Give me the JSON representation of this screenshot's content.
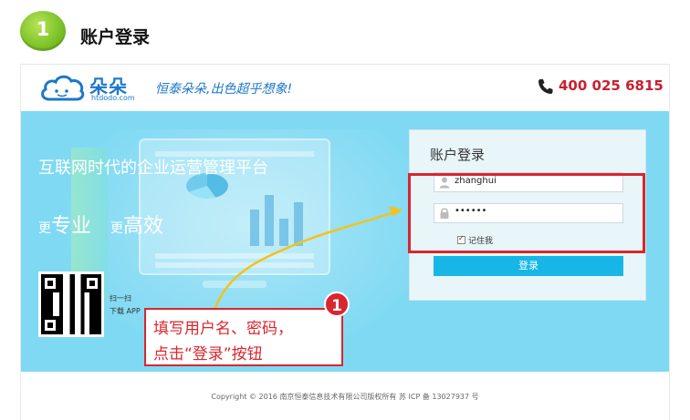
{
  "step": {
    "number": "1",
    "title": "账户登录"
  },
  "header": {
    "logo_text": "朵朵",
    "logo_domain": "htdodo.com",
    "slogan": "恒泰朵朵,出色超乎想象!",
    "phone": "400 025 6815",
    "icons": {
      "logo": "cloud-logo-icon",
      "phone": "phone-icon"
    }
  },
  "hero": {
    "headline": "互联网时代的企业运营管理平台",
    "tagline_a_prefix": "更",
    "tagline_a": "专业",
    "tagline_b_prefix": "更",
    "tagline_b": "高效",
    "qr_line1": "扫一扫",
    "qr_line2": "下载 APP"
  },
  "login": {
    "title": "账户登录",
    "username": "zhanghui",
    "password": "••••••",
    "remember_label": "记住我",
    "remember_checked": true,
    "submit_label": "登录",
    "icons": {
      "user": "user-icon",
      "lock": "lock-icon"
    }
  },
  "annotation": {
    "marker": "1",
    "line1": "填写用户名、密码，",
    "line2": "点击“登录”按钮"
  },
  "footer": {
    "copyright": "Copyright © 2016 南京恒泰信息技术有限公司版权所有 苏 ICP 备 13027937 号"
  },
  "colors": {
    "hero_bg": "#7fd9f3",
    "brand_blue": "#1c77c9",
    "phone_red": "#c8202f",
    "button": "#17b6e6",
    "annotation_red": "#d9262e",
    "step_green": "#7fc42a"
  }
}
